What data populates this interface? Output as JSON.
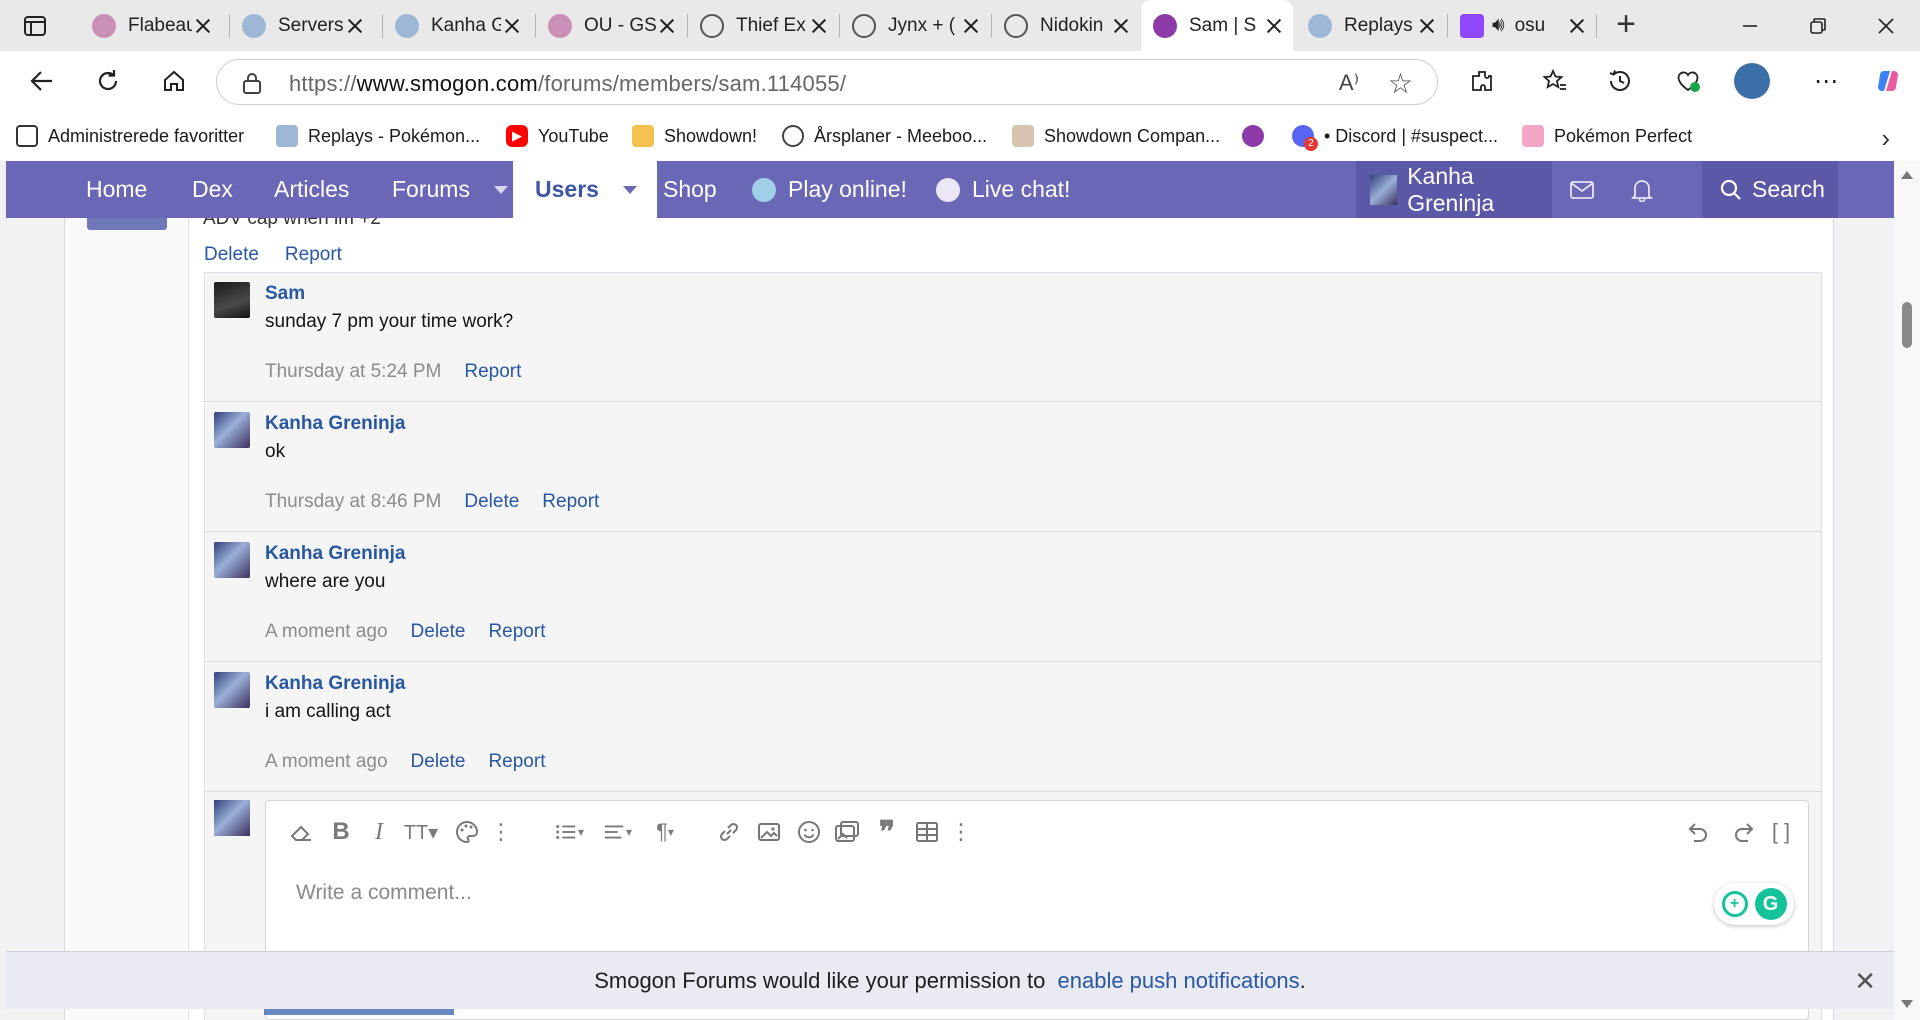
{
  "browser": {
    "tabs": [
      {
        "label": "Flabeau",
        "active": false
      },
      {
        "label": "Servers",
        "active": false
      },
      {
        "label": "Kanha G",
        "active": false
      },
      {
        "label": "OU - GS",
        "active": false
      },
      {
        "label": "Thief Ex",
        "active": false
      },
      {
        "label": "Jynx + (",
        "active": false
      },
      {
        "label": "Nidokin",
        "active": false
      },
      {
        "label": "Sam | S",
        "active": true
      },
      {
        "label": "Replays",
        "active": false
      },
      {
        "label": "osu",
        "active": false
      }
    ],
    "url_prefix": "https://",
    "url_host": "www.smogon.com",
    "url_path": "/forums/members/sam.114055/",
    "read_aloud_glyph": "A⁾",
    "bookmarks": [
      {
        "label": "Administrerede favoritter"
      },
      {
        "label": "Replays - Pokémon..."
      },
      {
        "label": "YouTube"
      },
      {
        "label": "Showdown!"
      },
      {
        "label": "Årsplaner - Meeboo..."
      },
      {
        "label": "Showdown Compan..."
      },
      {
        "label": ""
      },
      {
        "label": "• Discord | #suspect..."
      },
      {
        "label": "Pokémon Perfect"
      }
    ],
    "discord_badge": "2"
  },
  "nav": {
    "home": "Home",
    "dex": "Dex",
    "articles": "Articles",
    "forums": "Forums",
    "users": "Users",
    "shop": "Shop",
    "play_online": "Play online!",
    "live_chat": "Live chat!",
    "account_name": "Kanha Greninja",
    "search": "Search"
  },
  "previous_post": {
    "partial_text": "ADV cap when im +2",
    "delete": "Delete",
    "report": "Report"
  },
  "comments": [
    {
      "author": "Sam",
      "text": "sunday 7 pm your time work?",
      "time": "Thursday at 5:24 PM",
      "delete": "",
      "report": "Report"
    },
    {
      "author": "Kanha Greninja",
      "text": "ok",
      "time": "Thursday at 8:46 PM",
      "delete": "Delete",
      "report": "Report"
    },
    {
      "author": "Kanha Greninja",
      "text": "where are you",
      "time": "A moment ago",
      "delete": "Delete",
      "report": "Report"
    },
    {
      "author": "Kanha Greninja",
      "text": "i am calling act",
      "time": "A moment ago",
      "delete": "Delete",
      "report": "Report"
    }
  ],
  "editor": {
    "placeholder": "Write a comment..."
  },
  "push_notice": {
    "text": "Smogon Forums would like your permission to ",
    "link": "enable push notifications",
    "suffix": "."
  },
  "colors": {
    "nav_bg": "#6a67b6",
    "link": "#2857a4",
    "grammarly": "#15c39a"
  }
}
